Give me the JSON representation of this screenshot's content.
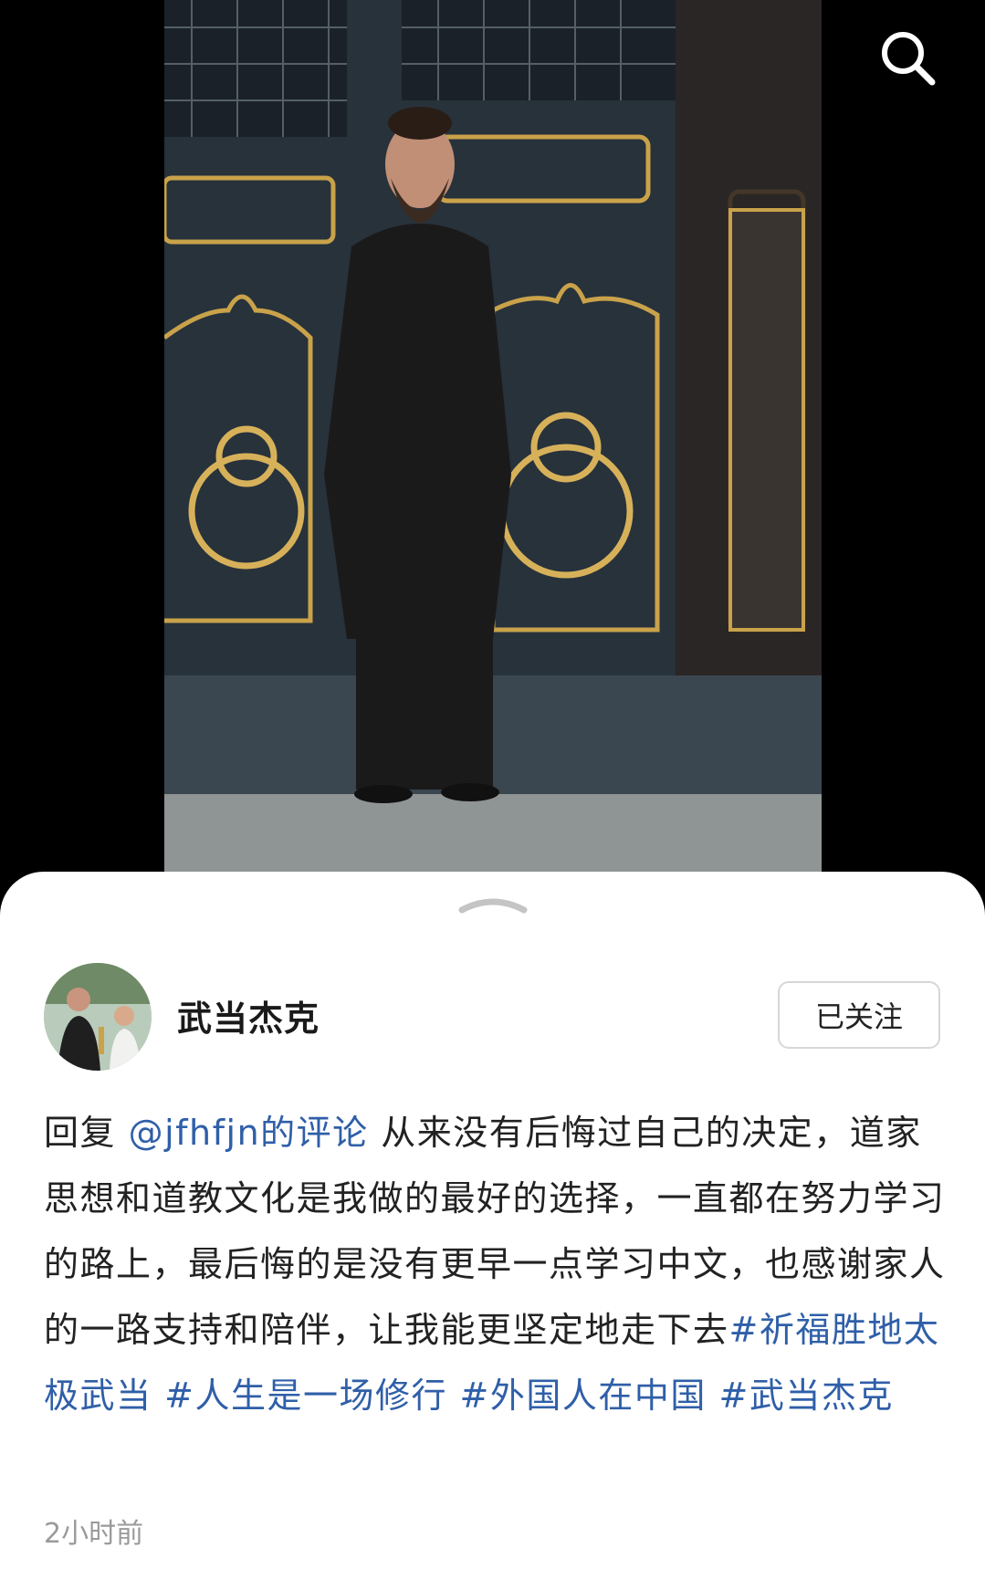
{
  "header": {
    "search_icon": "search-icon"
  },
  "sheet": {
    "handle_icon": "chevron-up-icon"
  },
  "author": {
    "name": "武当杰克",
    "follow_label": "已关注"
  },
  "post": {
    "reply_prefix": "回复",
    "mention": "@jfhfjn的评论",
    "body": " 从来没有后悔过自己的决定，道家思想和道教文化是我做的最好的选择，一直都在努力学习的路上，最后悔的是没有更早一点学习中文，也感谢家人的一路支持和陪伴，让我能更坚定地走下去",
    "hashtags": [
      "#祈福胜地太极武当",
      "#人生是一场修行",
      "#外国人在中国",
      "#武当杰克"
    ],
    "timestamp": "2小时前"
  },
  "colors": {
    "link": "#2f5fa8",
    "accent_gold": "#c9a24a"
  }
}
